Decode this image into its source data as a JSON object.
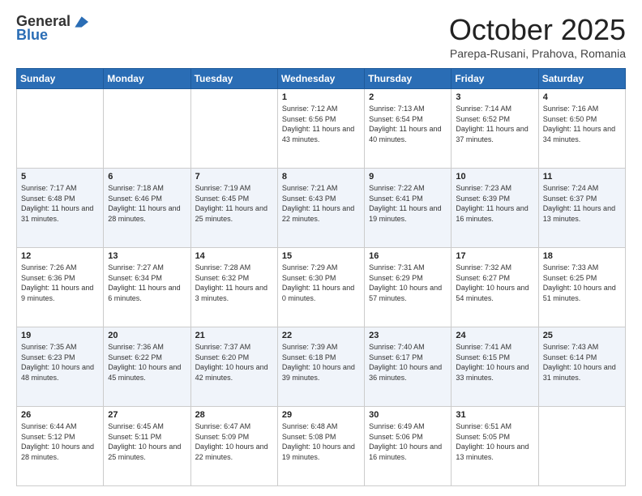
{
  "logo": {
    "line1": "General",
    "line2": "Blue"
  },
  "header": {
    "month": "October 2025",
    "location": "Parepa-Rusani, Prahova, Romania"
  },
  "weekdays": [
    "Sunday",
    "Monday",
    "Tuesday",
    "Wednesday",
    "Thursday",
    "Friday",
    "Saturday"
  ],
  "weeks": [
    [
      {
        "day": "",
        "info": ""
      },
      {
        "day": "",
        "info": ""
      },
      {
        "day": "",
        "info": ""
      },
      {
        "day": "1",
        "info": "Sunrise: 7:12 AM\nSunset: 6:56 PM\nDaylight: 11 hours and 43 minutes."
      },
      {
        "day": "2",
        "info": "Sunrise: 7:13 AM\nSunset: 6:54 PM\nDaylight: 11 hours and 40 minutes."
      },
      {
        "day": "3",
        "info": "Sunrise: 7:14 AM\nSunset: 6:52 PM\nDaylight: 11 hours and 37 minutes."
      },
      {
        "day": "4",
        "info": "Sunrise: 7:16 AM\nSunset: 6:50 PM\nDaylight: 11 hours and 34 minutes."
      }
    ],
    [
      {
        "day": "5",
        "info": "Sunrise: 7:17 AM\nSunset: 6:48 PM\nDaylight: 11 hours and 31 minutes."
      },
      {
        "day": "6",
        "info": "Sunrise: 7:18 AM\nSunset: 6:46 PM\nDaylight: 11 hours and 28 minutes."
      },
      {
        "day": "7",
        "info": "Sunrise: 7:19 AM\nSunset: 6:45 PM\nDaylight: 11 hours and 25 minutes."
      },
      {
        "day": "8",
        "info": "Sunrise: 7:21 AM\nSunset: 6:43 PM\nDaylight: 11 hours and 22 minutes."
      },
      {
        "day": "9",
        "info": "Sunrise: 7:22 AM\nSunset: 6:41 PM\nDaylight: 11 hours and 19 minutes."
      },
      {
        "day": "10",
        "info": "Sunrise: 7:23 AM\nSunset: 6:39 PM\nDaylight: 11 hours and 16 minutes."
      },
      {
        "day": "11",
        "info": "Sunrise: 7:24 AM\nSunset: 6:37 PM\nDaylight: 11 hours and 13 minutes."
      }
    ],
    [
      {
        "day": "12",
        "info": "Sunrise: 7:26 AM\nSunset: 6:36 PM\nDaylight: 11 hours and 9 minutes."
      },
      {
        "day": "13",
        "info": "Sunrise: 7:27 AM\nSunset: 6:34 PM\nDaylight: 11 hours and 6 minutes."
      },
      {
        "day": "14",
        "info": "Sunrise: 7:28 AM\nSunset: 6:32 PM\nDaylight: 11 hours and 3 minutes."
      },
      {
        "day": "15",
        "info": "Sunrise: 7:29 AM\nSunset: 6:30 PM\nDaylight: 11 hours and 0 minutes."
      },
      {
        "day": "16",
        "info": "Sunrise: 7:31 AM\nSunset: 6:29 PM\nDaylight: 10 hours and 57 minutes."
      },
      {
        "day": "17",
        "info": "Sunrise: 7:32 AM\nSunset: 6:27 PM\nDaylight: 10 hours and 54 minutes."
      },
      {
        "day": "18",
        "info": "Sunrise: 7:33 AM\nSunset: 6:25 PM\nDaylight: 10 hours and 51 minutes."
      }
    ],
    [
      {
        "day": "19",
        "info": "Sunrise: 7:35 AM\nSunset: 6:23 PM\nDaylight: 10 hours and 48 minutes."
      },
      {
        "day": "20",
        "info": "Sunrise: 7:36 AM\nSunset: 6:22 PM\nDaylight: 10 hours and 45 minutes."
      },
      {
        "day": "21",
        "info": "Sunrise: 7:37 AM\nSunset: 6:20 PM\nDaylight: 10 hours and 42 minutes."
      },
      {
        "day": "22",
        "info": "Sunrise: 7:39 AM\nSunset: 6:18 PM\nDaylight: 10 hours and 39 minutes."
      },
      {
        "day": "23",
        "info": "Sunrise: 7:40 AM\nSunset: 6:17 PM\nDaylight: 10 hours and 36 minutes."
      },
      {
        "day": "24",
        "info": "Sunrise: 7:41 AM\nSunset: 6:15 PM\nDaylight: 10 hours and 33 minutes."
      },
      {
        "day": "25",
        "info": "Sunrise: 7:43 AM\nSunset: 6:14 PM\nDaylight: 10 hours and 31 minutes."
      }
    ],
    [
      {
        "day": "26",
        "info": "Sunrise: 6:44 AM\nSunset: 5:12 PM\nDaylight: 10 hours and 28 minutes."
      },
      {
        "day": "27",
        "info": "Sunrise: 6:45 AM\nSunset: 5:11 PM\nDaylight: 10 hours and 25 minutes."
      },
      {
        "day": "28",
        "info": "Sunrise: 6:47 AM\nSunset: 5:09 PM\nDaylight: 10 hours and 22 minutes."
      },
      {
        "day": "29",
        "info": "Sunrise: 6:48 AM\nSunset: 5:08 PM\nDaylight: 10 hours and 19 minutes."
      },
      {
        "day": "30",
        "info": "Sunrise: 6:49 AM\nSunset: 5:06 PM\nDaylight: 10 hours and 16 minutes."
      },
      {
        "day": "31",
        "info": "Sunrise: 6:51 AM\nSunset: 5:05 PM\nDaylight: 10 hours and 13 minutes."
      },
      {
        "day": "",
        "info": ""
      }
    ]
  ]
}
